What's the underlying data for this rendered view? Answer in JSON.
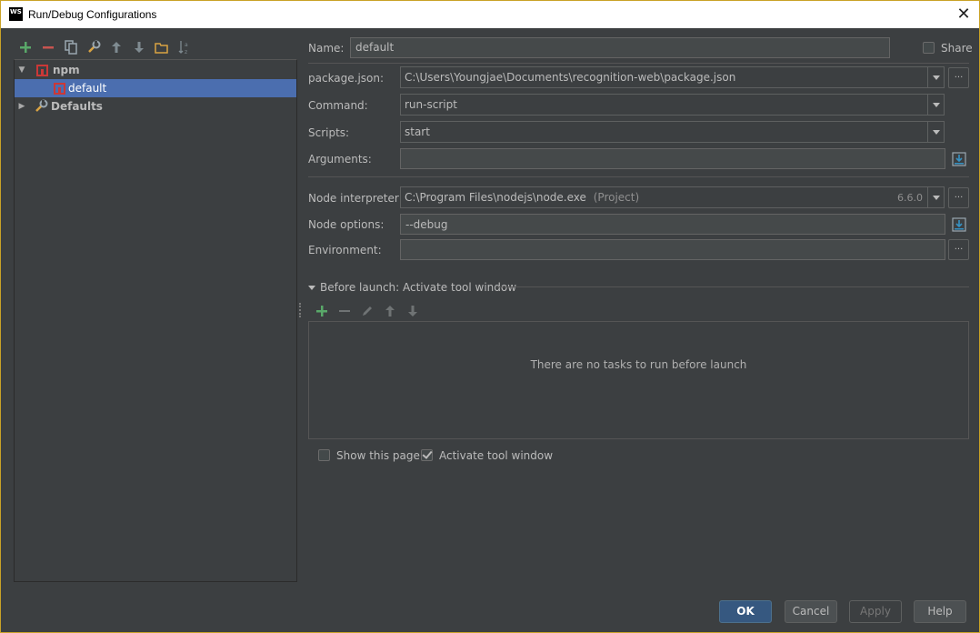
{
  "window": {
    "title": "Run/Debug Configurations",
    "app_icon_text": "WS",
    "close_symbol": "✕"
  },
  "toolbar": {
    "icons": [
      "add-icon",
      "remove-icon",
      "copy-icon",
      "wrench-icon",
      "move-up-icon",
      "move-down-icon",
      "folder-icon",
      "sort-icon"
    ]
  },
  "tree": {
    "npm_label": "npm",
    "default_label": "default",
    "defaults_label": "Defaults"
  },
  "form": {
    "name_label": "Name:",
    "name_value": "default",
    "share_label": "Share",
    "package_label": "package.json:",
    "package_value": "C:\\Users\\Youngjae\\Documents\\recognition-web\\package.json",
    "command_label": "Command:",
    "command_value": "run-script",
    "scripts_label": "Scripts:",
    "scripts_value": "start",
    "arguments_label": "Arguments:",
    "arguments_value": "",
    "node_interpreter_label": "Node interpreter:",
    "node_interpreter_value": "C:\\Program Files\\nodejs\\node.exe",
    "node_interpreter_suffix": "(Project)",
    "node_version": "6.6.0",
    "node_options_label": "Node options:",
    "node_options_value": "--debug",
    "environment_label": "Environment:",
    "environment_value": "",
    "browse_symbol": "..."
  },
  "before_launch": {
    "title": "Before launch: Activate tool window",
    "empty_text": "There are no tasks to run before launch",
    "show_page_label": "Show this page",
    "show_page_checked": false,
    "activate_tool_label": "Activate tool window",
    "activate_tool_checked": true
  },
  "buttons": {
    "ok": "OK",
    "cancel": "Cancel",
    "apply": "Apply",
    "help": "Help"
  },
  "colors": {
    "background": "#3c3f41",
    "selection": "#4b6eaf",
    "add_green": "#59a869",
    "remove_red": "#c75450",
    "npm_red": "#cb3837"
  }
}
